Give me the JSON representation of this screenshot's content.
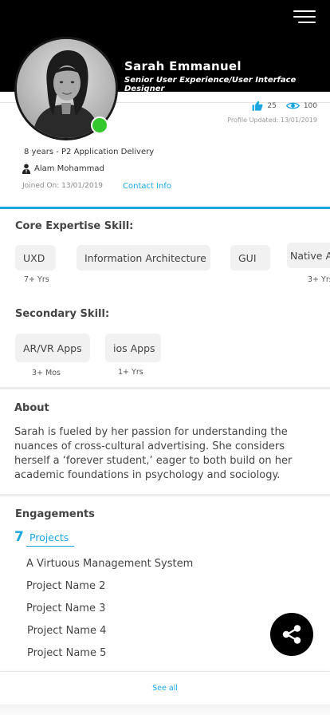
{
  "header": {
    "menu_icon": "hamburger-menu-icon"
  },
  "profile": {
    "name": "Sarah Emmanuel",
    "title": "Senior User Experience/User Interface Designer",
    "online": true,
    "likes": "25",
    "views": "100",
    "profile_updated": "Profile Updated: 13/01/2019",
    "experience": "8 years - P2 Application Delivery",
    "manager": "Alam Mohammad",
    "joined": "Joined On: 13/01/2019",
    "contact_label": "Contact Info"
  },
  "core_skills": {
    "title": "Core Expertise Skill:",
    "items": [
      {
        "label": "UXD",
        "years": "7+ Yrs"
      },
      {
        "label": "Information Architecture",
        "years": ""
      },
      {
        "label": "GUI",
        "years": ""
      },
      {
        "label": "Native A",
        "years": "3+ Yrs"
      }
    ]
  },
  "secondary_skills": {
    "title": "Secondary Skill:",
    "items": [
      {
        "label": "AR/VR Apps",
        "years": "3+ Mos"
      },
      {
        "label": "ios Apps",
        "years": "1+ Yrs"
      }
    ]
  },
  "about": {
    "title": "About",
    "text": "Sarah is fueled by her passion for understanding the nuances of cross-cultural advertising. She considers herself a ‘forever student,’ eager to both build on her academic foundations in psychology and sociology."
  },
  "engagements": {
    "title": "Engagements",
    "count": "7",
    "tab_label": "Projects",
    "projects": [
      "A Virtuous Management System",
      "Project Name 2",
      "Project Name 3",
      "Project Name 4",
      "Project Name 5"
    ],
    "see_all": "See all"
  },
  "colors": {
    "accent": "#1aa7e1",
    "online": "#35c82d",
    "header_bg": "#000000"
  }
}
